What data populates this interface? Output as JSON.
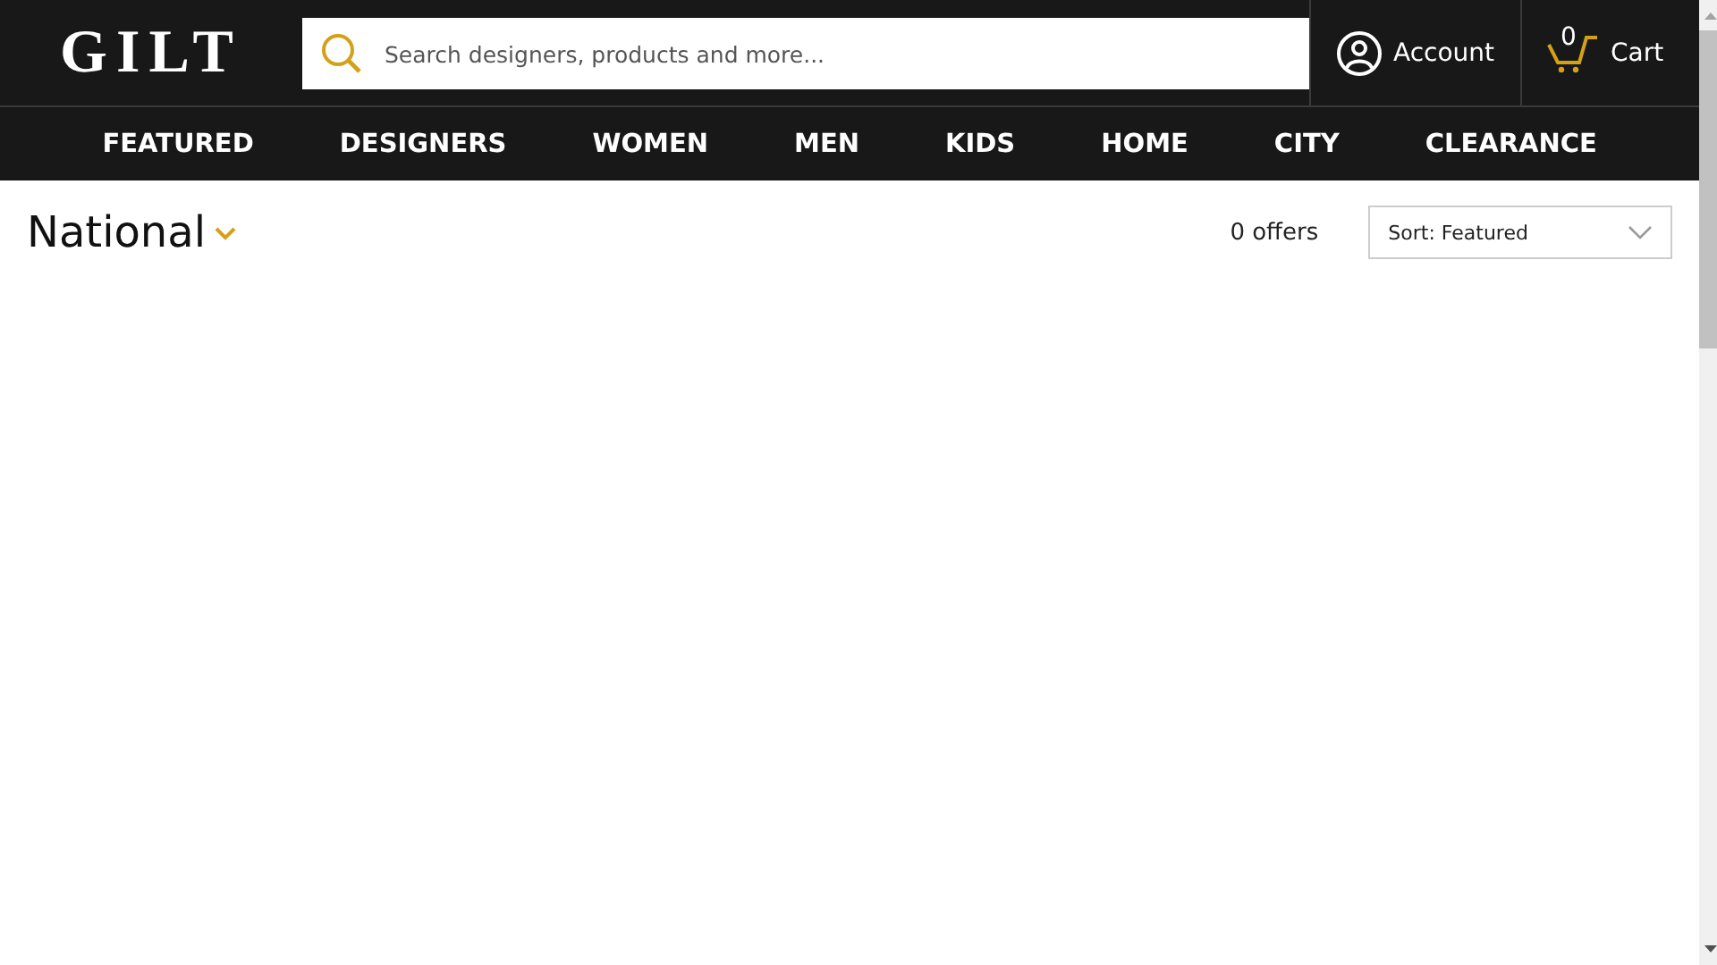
{
  "header": {
    "logo": "GILT",
    "search": {
      "placeholder": "Search designers, products and more..."
    },
    "account": "Account",
    "cart": {
      "count": "0",
      "label": "Cart"
    }
  },
  "nav": [
    "FEATURED",
    "DESIGNERS",
    "WOMEN",
    "MEN",
    "KIDS",
    "HOME",
    "CITY",
    "CLEARANCE"
  ],
  "listing": {
    "location": "National",
    "offers": "0 offers",
    "sort": "Sort: Featured"
  }
}
